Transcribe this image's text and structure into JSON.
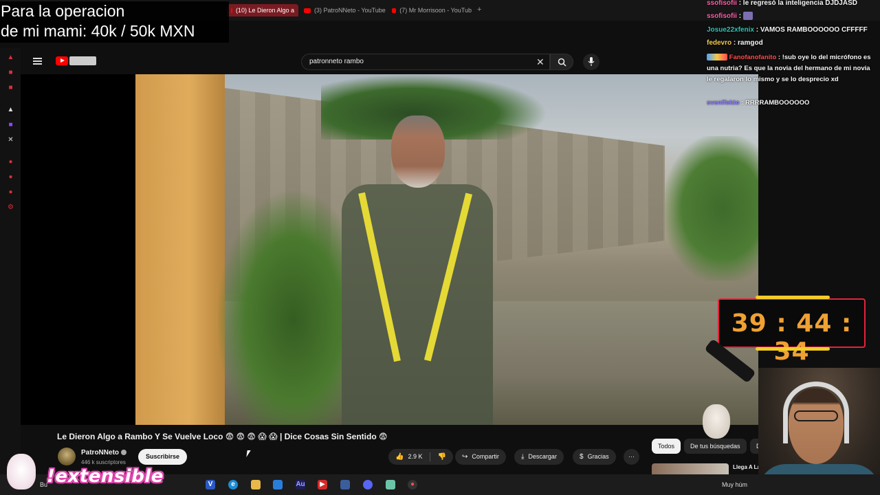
{
  "browser": {
    "tabs": [
      {
        "label": "(10) Le Dieron Algo a",
        "active": true
      },
      {
        "label": "(3) PatroNNeto - YouTube",
        "active": false
      },
      {
        "label": "(7) Mr Morrisoon - YouTub",
        "active": false
      }
    ]
  },
  "stream_overlay": {
    "goal_line1": "Para la operacion",
    "goal_line2": "de mi mami: 40k / 50k MXN",
    "timer": "39 : 44 : 34",
    "brand": "!extensible"
  },
  "chat": [
    {
      "user": "ssofisofii",
      "message": ": le regresó la inteligencia DJDJASD",
      "color": "#ff5ea8"
    },
    {
      "user": "ssofisofii",
      "message": ":",
      "color": "#ff5ea8"
    },
    {
      "user": "Josue22xfenix",
      "message": ": VAMOS RAMBOOOOOO CFFFFF",
      "color": "#2fc4b2"
    },
    {
      "user": "fedevro",
      "message": ": ramgod",
      "color": "#f2c94c"
    },
    {
      "user": "Fanofanofanito",
      "message": ": !sub oye lo del micrófono es una nutria? Es que la novia del hermano de mi novia le regalaron lo mismo y se lo desprecio xd",
      "color": "#ff4a4a"
    },
    {
      "user": "svenffekto",
      "message": ": RRRRAMBOOOOOO",
      "color": "#8a7cff"
    }
  ],
  "youtube": {
    "search_query": "patronneto rambo",
    "video_title": "Le Dieron Algo a Rambo Y Se Vuelve Loco 😨 😨 😨 😱 😱 | Dice Cosas Sin Sentido 😨",
    "channel_name": "PatroNNeto",
    "subscribers": "446 k suscriptores",
    "subscribe_label": "Suscribirse",
    "likes": "2.9 K",
    "share_label": "Compartir",
    "download_label": "Descargar",
    "thanks_label": "Gracias",
    "chips": [
      "Todos",
      "De tus búsquedas",
      "De Patro"
    ],
    "suggested_title": "Llega A La F"
  },
  "colors": {
    "yt_red": "#ff0000",
    "timer_border": "#e8223d",
    "timer_digits": "#f0a132",
    "timer_accent": "#f2cc28"
  },
  "taskbar": {
    "search_text": "Bu",
    "weather_text": "Muy húm"
  }
}
